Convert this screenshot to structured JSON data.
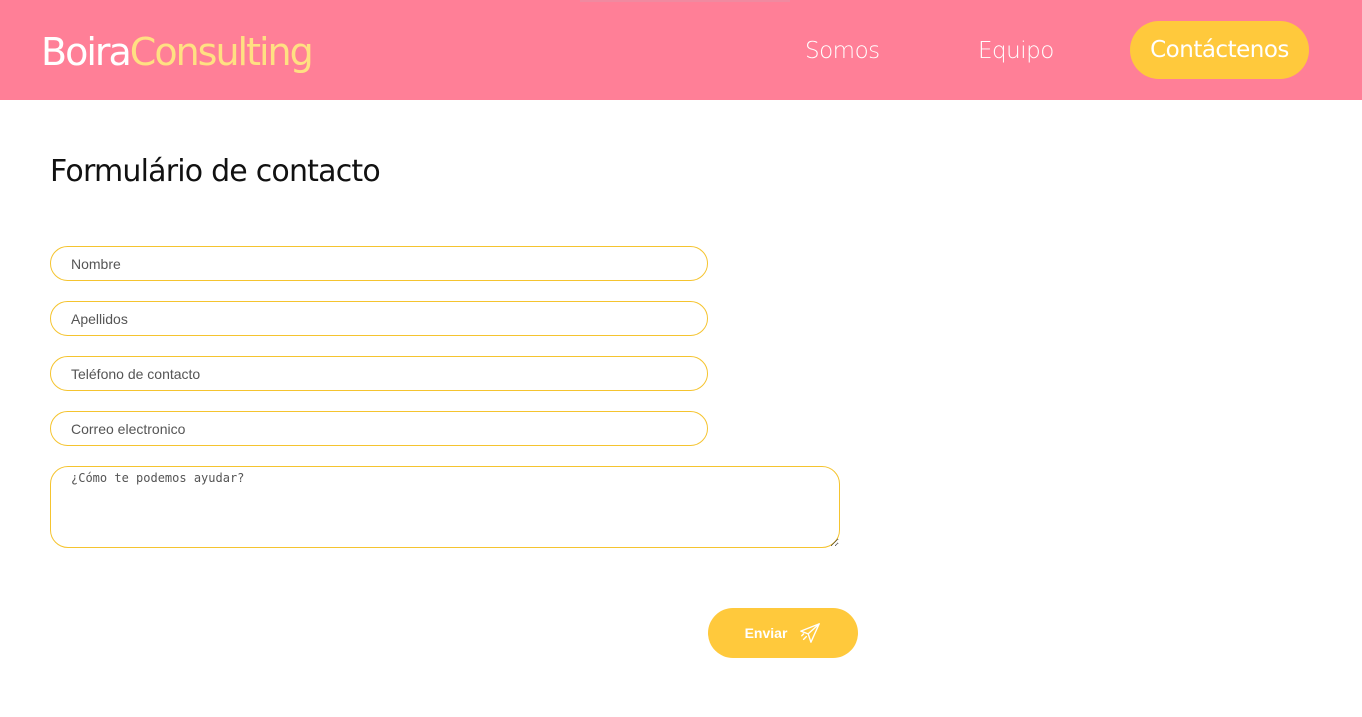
{
  "brand": {
    "name_part1": "Boira",
    "name_part2": "Consulting"
  },
  "nav": {
    "items": [
      {
        "label": "Somos"
      },
      {
        "label": "Equipo"
      }
    ],
    "cta_label": "Contáctenos"
  },
  "form": {
    "title": "Formulário de contacto",
    "fields": {
      "nombre": {
        "placeholder": "Nombre",
        "value": ""
      },
      "apellidos": {
        "placeholder": "Apellidos",
        "value": ""
      },
      "telefono": {
        "placeholder": "Teléfono de contacto",
        "value": ""
      },
      "correo": {
        "placeholder": "Correo electronico",
        "value": ""
      },
      "mensaje": {
        "placeholder": "¿Cómo te podemos ayudar?",
        "value": ""
      }
    },
    "submit_label": "Enviar",
    "submit_icon": "paper-plane-icon"
  },
  "colors": {
    "header_bg": "#ff7f97",
    "accent": "#ffc93c",
    "brand_secondary": "#ffe082",
    "field_border": "#f5c42f"
  }
}
